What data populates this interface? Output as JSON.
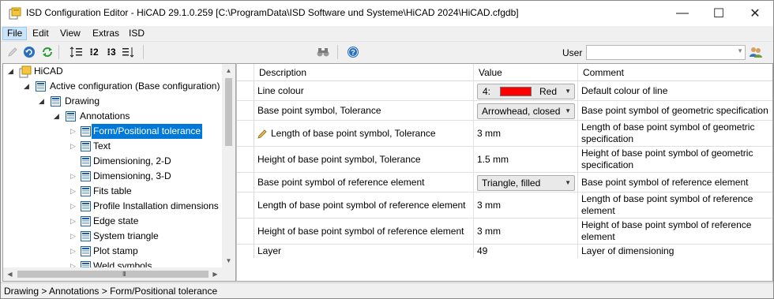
{
  "window": {
    "title": "ISD Configuration Editor  -  HiCAD 29.1.0.259 [C:\\ProgramData\\ISD Software und Systeme\\HiCAD 2024\\HiCAD.cfgdb]",
    "minimize_glyph": "—",
    "maximize_glyph": "☐",
    "close_glyph": "✕"
  },
  "menu": [
    "File",
    "Edit",
    "View",
    "Extras",
    "ISD"
  ],
  "toolbar": {
    "icons": [
      "pencil-icon",
      "undo-icon",
      "refresh-icon",
      "tree-expand-icon",
      "numbered-list-2-icon",
      "numbered-list-3-icon",
      "sort-down-icon",
      "binoculars-icon",
      "help-icon"
    ],
    "numbered_2": "2",
    "numbered_3": "3",
    "user_label": "User",
    "user_value": ""
  },
  "tree": {
    "root": "HiCAD",
    "active_config": "Active configuration (Base configuration)",
    "drawing": "Drawing",
    "annotations": "Annotations",
    "children": [
      "Form/Positional tolerance",
      "Text",
      "Dimensioning, 2-D",
      "Dimensioning, 3-D",
      "Fits table",
      "Profile Installation dimensions",
      "Edge state",
      "System triangle",
      "Plot stamp",
      "Weld symbols"
    ],
    "selected": "Form/Positional tolerance",
    "hscroll_grip": "III"
  },
  "grid": {
    "headers": [
      "Description",
      "Value",
      "Comment"
    ],
    "rows": [
      {
        "description": "Line colour",
        "value": "",
        "comment": "Default colour of line"
      },
      {
        "description": "Base point symbol, Tolerance",
        "value": "Arrowhead, closed",
        "comment": "Base point symbol of geometric specification"
      },
      {
        "description": "Length of base point symbol, Tolerance",
        "value": "3 mm",
        "comment": "Length of base point symbol of geometric specification"
      },
      {
        "description": "Height of base point symbol, Tolerance",
        "value": "1.5 mm",
        "comment": "Height of base point symbol of geometric specification"
      },
      {
        "description": "Base point symbol of reference element",
        "value": "Triangle, filled",
        "comment": "Base point symbol of reference element"
      },
      {
        "description": "Length of base point symbol of reference element",
        "value": "3 mm",
        "comment": "Length of base point symbol of reference element"
      },
      {
        "description": "Height of base point symbol of reference element",
        "value": "3 mm",
        "comment": "Height of base point symbol of reference element"
      },
      {
        "description": "Layer",
        "value": "49",
        "comment": "Layer of dimensioning"
      }
    ],
    "color_value": {
      "number": "4:",
      "name": "Red",
      "swatch": "#ff0000"
    }
  },
  "status": {
    "breadcrumb": "Drawing > Annotations > Form/Positional tolerance"
  },
  "colors": {
    "selection": "#0078d7",
    "menu_active": "#cce4f7"
  }
}
